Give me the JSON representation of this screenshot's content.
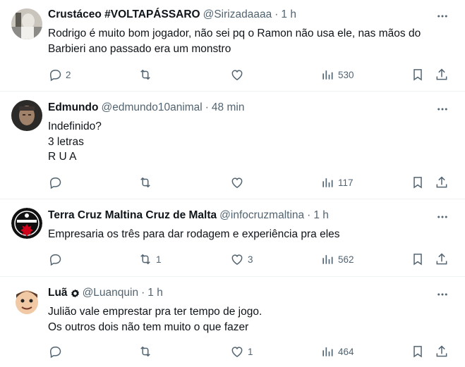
{
  "tweets": [
    {
      "name": "Crustáceo #VOLTAPÁSSARO",
      "handle": "@Sirizadaaaa",
      "time": "1 h",
      "lines": [
        "Rodrigo é muito bom jogador, não sei pq o Ramon não usa ele, nas mãos do",
        "Barbieri ano passado era um monstro"
      ],
      "replies": "2",
      "retweets": "",
      "likes": "",
      "views": "530"
    },
    {
      "name": "Edmundo",
      "handle": "@edmundo10animal",
      "time": "48 min",
      "lines": [
        "Indefinido?",
        "3 letras",
        "R U A"
      ],
      "replies": "",
      "retweets": "",
      "likes": "",
      "views": "117"
    },
    {
      "name": "Terra Cruz Maltina Cruz de Malta",
      "handle": "@infocruzmaltina",
      "time": "1 h",
      "lines": [
        "Empresaria os três para dar rodagem e experiência pra eles"
      ],
      "replies": "",
      "retweets": "1",
      "likes": "3",
      "views": "562"
    },
    {
      "name": "Luã",
      "handle": "@Luanquin",
      "time": "1 h",
      "lines": [
        "Julião vale emprestar pra ter tempo de jogo.",
        "Os outros dois não tem muito o que fazer"
      ],
      "replies": "",
      "retweets": "",
      "likes": "1",
      "views": "464"
    }
  ],
  "separator": "·",
  "icons": {
    "reply": "reply-icon",
    "retweet": "retweet-icon",
    "like": "heart-icon",
    "views": "views-icon",
    "bookmark": "bookmark-icon",
    "share": "share-icon",
    "more": "more-icon"
  },
  "colors": {
    "text": "#0f1419",
    "secondary": "#536471",
    "border": "#eff3f4"
  }
}
